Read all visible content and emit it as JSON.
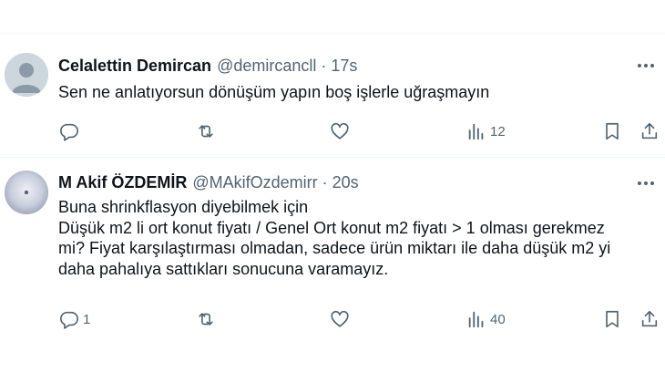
{
  "tweets": [
    {
      "name": "Celalettin Demircan",
      "handle": "@demircancll",
      "separator": "·",
      "time": "17s",
      "lines": [
        "Sen ne anlatıyorsun dönüşüm yapın boş işlerle uğraşmayın"
      ],
      "replies": "",
      "reposts": "",
      "likes": "",
      "views": "12"
    },
    {
      "name": "M Akif ÖZDEMİR",
      "handle": "@MAkifOzdemirr",
      "separator": "·",
      "time": "20s",
      "lines": [
        "Buna shrinkflasyon diyebilmek için",
        "Düşük m2 li ort konut fiyatı / Genel Ort konut m2 fiyatı > 1 olması gerekmez",
        "mi? Fiyat karşılaştırması olmadan, sadece ürün miktarı ile daha düşük m2 yi",
        "daha pahalıya sattıkları sonucuna varamayız."
      ],
      "replies": "1",
      "reposts": "",
      "likes": "",
      "views": "40"
    }
  ],
  "icons": {
    "more": "more-dots-icon",
    "reply": "reply-icon",
    "repost": "repost-icon",
    "like": "heart-icon",
    "views": "views-chart-icon",
    "bookmark": "bookmark-icon",
    "share": "share-icon"
  },
  "colors": {
    "text": "#0f1419",
    "secondary": "#536471",
    "divider": "#eff3f4",
    "avatar_default": "#ccd6dd"
  }
}
